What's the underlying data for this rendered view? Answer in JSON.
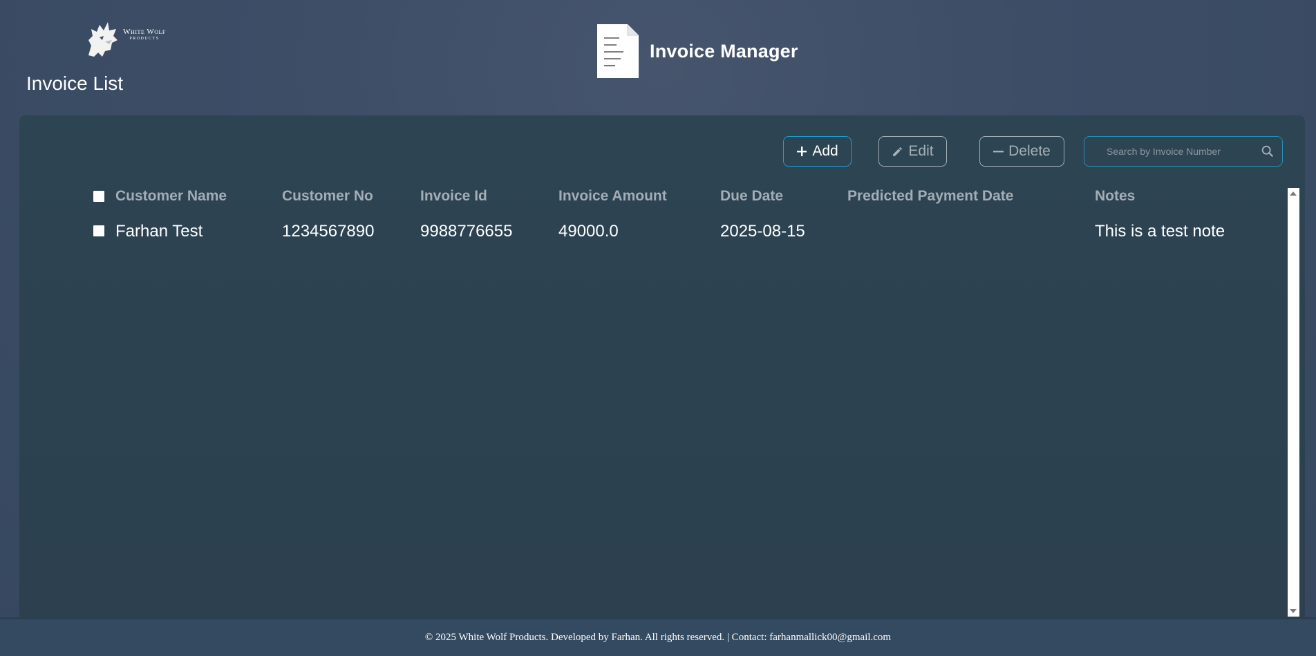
{
  "logo": {
    "line1": "White Wolf",
    "line2": "PRODUCTS"
  },
  "page_title": "Invoice List",
  "brand": {
    "name": "Invoice Manager",
    "icon": "document-icon"
  },
  "toolbar": {
    "add_label": "Add",
    "edit_label": "Edit",
    "delete_label": "Delete",
    "search_placeholder": "Search by Invoice Number",
    "search_value": ""
  },
  "table": {
    "columns": [
      "Customer Name",
      "Customer No",
      "Invoice Id",
      "Invoice Amount",
      "Due Date",
      "Predicted Payment Date",
      "Notes"
    ],
    "rows": [
      [
        "Farhan Test",
        "1234567890",
        "9988776655",
        "49000.0",
        "2025-08-15",
        "",
        "This is a test note"
      ]
    ]
  },
  "footer": {
    "text": "© 2025 White Wolf Products. Developed by Farhan. All rights reserved. | Contact: farhanmallick00@gmail.com"
  },
  "colors": {
    "accent": "#1a9fd6",
    "panel": "#2d4452",
    "background": "#3d4d66"
  }
}
